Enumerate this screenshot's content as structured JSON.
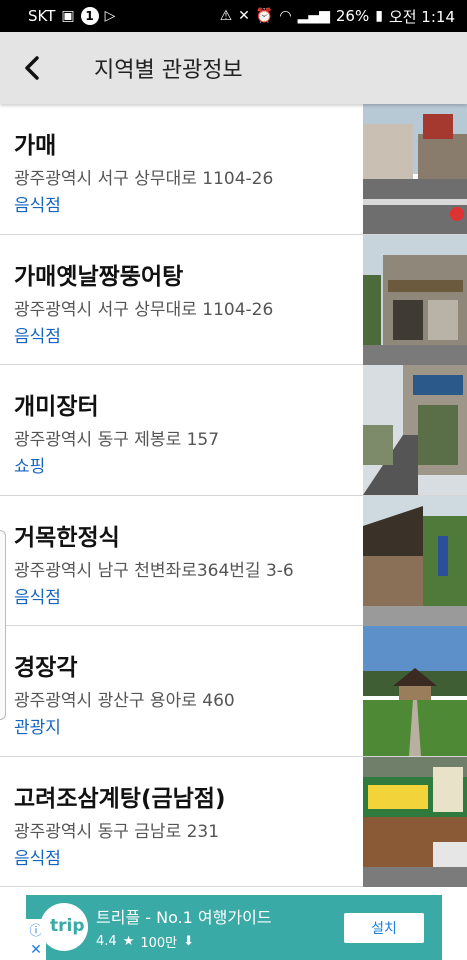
{
  "status_bar": {
    "carrier": "SKT",
    "notification_count": "1",
    "battery": "26%",
    "time": "오전 1:14"
  },
  "header": {
    "title": "지역별 관광정보",
    "back_icon": "chevron-left-icon"
  },
  "places": [
    {
      "name": "가매",
      "address": "광주광역시 서구 상무대로 1104-26",
      "category": "음식점"
    },
    {
      "name": "가매옛날짱뚱어탕",
      "address": "광주광역시 서구 상무대로 1104-26",
      "category": "음식점"
    },
    {
      "name": "개미장터",
      "address": "광주광역시 동구 제봉로 157",
      "category": "쇼핑"
    },
    {
      "name": "거목한정식",
      "address": "광주광역시 남구 천변좌로364번길 3-6",
      "category": "음식점"
    },
    {
      "name": "경장각",
      "address": "광주광역시 광산구 용아로 460",
      "category": "관광지"
    },
    {
      "name": "고려조삼계탕(금남점)",
      "address": "광주광역시 동구 금남로 231",
      "category": "음식점"
    }
  ],
  "ad": {
    "logo_text": "trip",
    "title": "트리플 - No.1 여행가이드",
    "rating": "4.4",
    "downloads": "100만",
    "install_label": "설치",
    "info_icon": "info-icon",
    "close_icon": "close-icon"
  },
  "colors": {
    "category_text": "#1565c0",
    "app_bar": "#e4e4e4",
    "ad_background": "#3aaaa6"
  }
}
